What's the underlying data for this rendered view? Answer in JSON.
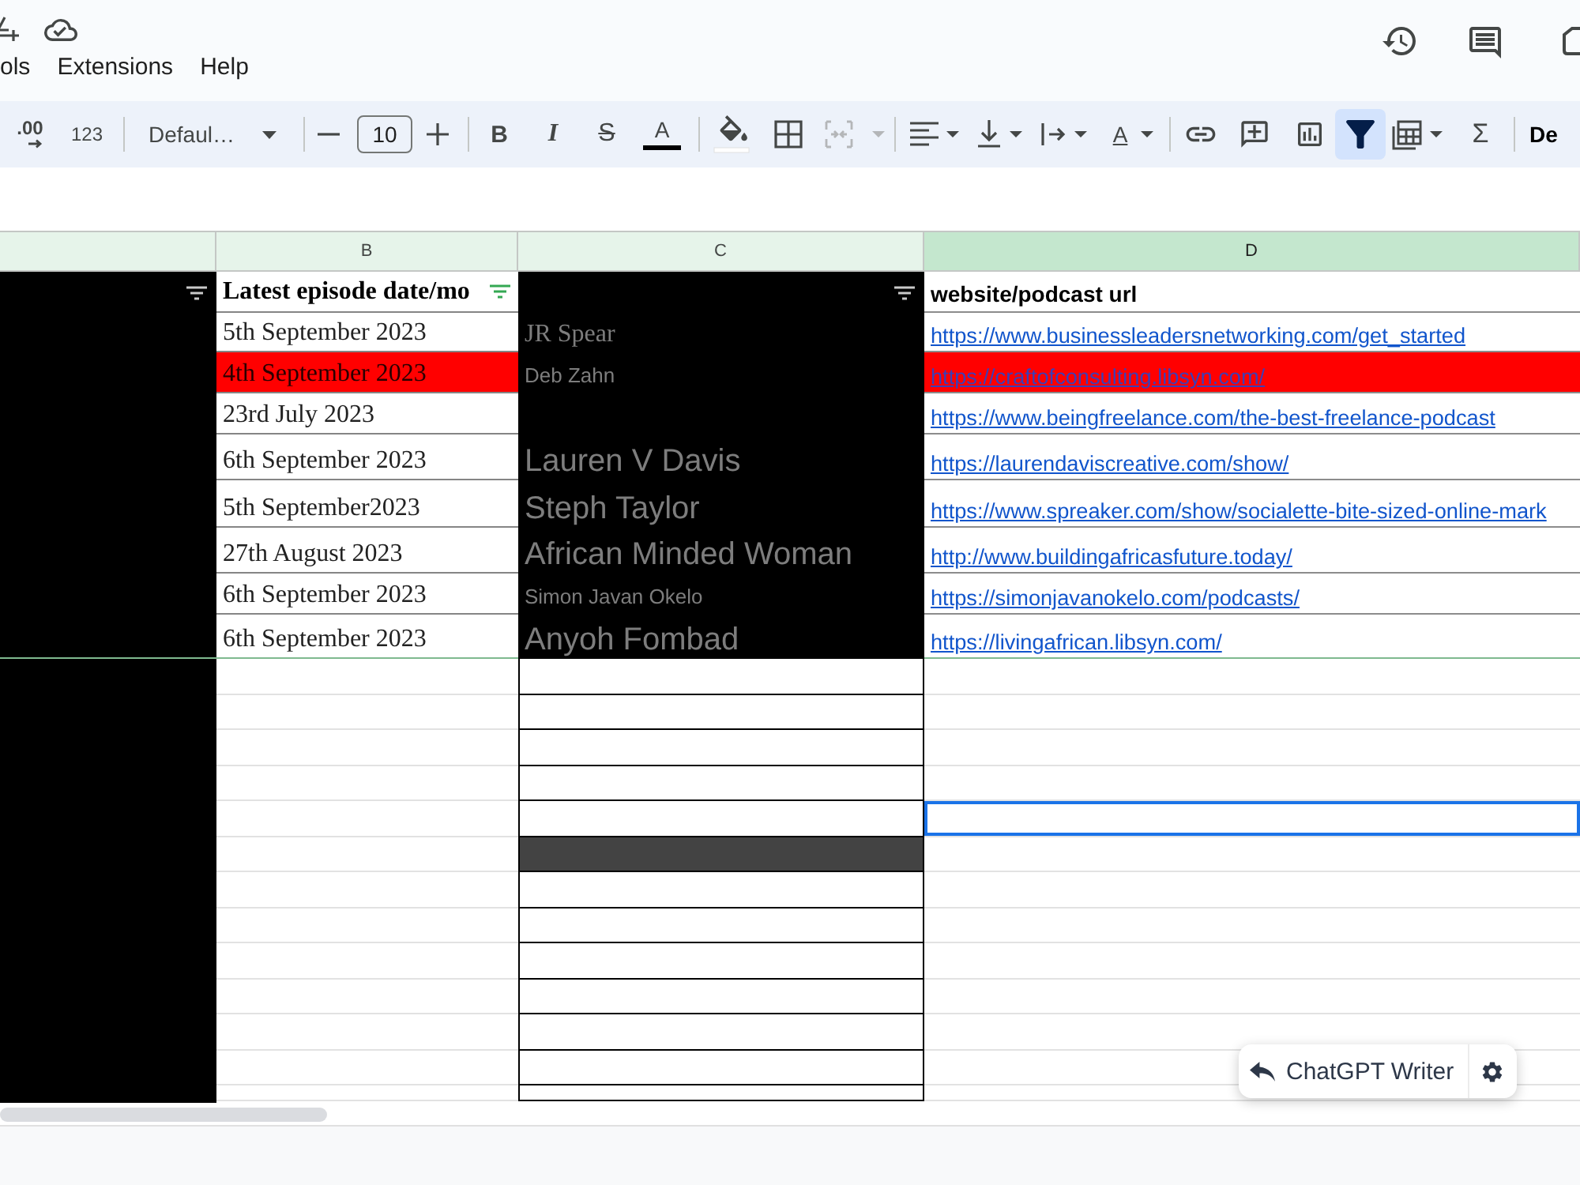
{
  "top_bar": {
    "menu": [
      "ols",
      "Extensions",
      "Help"
    ]
  },
  "toolbar": {
    "decimal": ".00",
    "number_format": "123",
    "font": "Defaul…",
    "font_size": "10",
    "format_letters": [
      "B",
      "I",
      "S",
      "A"
    ],
    "rotate_letter": "A",
    "sum": "Σ",
    "filter_selected": true,
    "cut_label": "De"
  },
  "sheet": {
    "columns": [
      {
        "letter": "B",
        "selected": false
      },
      {
        "letter": "C",
        "selected": false
      },
      {
        "letter": "D",
        "selected": true
      }
    ],
    "filters": [
      {
        "active": false
      },
      {
        "active": true
      },
      {
        "active": false
      }
    ],
    "header": {
      "date": "Latest episode date/mo",
      "url": "website/podcast url"
    },
    "rows": [
      {
        "date": "5th September 2023",
        "name": "JR Spear",
        "url": "https://www.businessleadersnetworking.com/get_started",
        "highlighted": false
      },
      {
        "date": "4th September 2023",
        "name": "Deb Zahn",
        "url": "https://craftofconsulting.libsyn.com/",
        "highlighted": true
      },
      {
        "date": "23rd July 2023",
        "url": "https://www.beingfreelance.com/the-best-freelance-podcast",
        "highlighted": false
      },
      {
        "date": "6th September 2023",
        "name": "Lauren V Davis",
        "url": "https://laurendaviscreative.com/show/",
        "highlighted": false
      },
      {
        "date": "5th September2023",
        "name": "Steph Taylor",
        "url": "https://www.spreaker.com/show/socialette-bite-sized-online-mark",
        "highlighted": false
      },
      {
        "date": "27th August 2023",
        "name": "African Minded Woman",
        "url": "http://www.buildingafricasfuture.today/",
        "highlighted": false
      },
      {
        "date": "6th September 2023",
        "name": "Simon Javan Okelo",
        "url": "https://simonjavanokelo.com/podcasts/",
        "highlighted": false
      },
      {
        "date": "6th September 2023",
        "name": "Anyoh Fombad",
        "url": "https://livingafrican.libsyn.com/",
        "highlighted": false
      }
    ],
    "empty_rows": [
      {
        "selected": false,
        "shaded": false
      },
      {
        "selected": false,
        "shaded": false
      },
      {
        "selected": false,
        "shaded": false
      },
      {
        "selected": false,
        "shaded": false
      },
      {
        "selected": true,
        "shaded": false
      },
      {
        "selected": false,
        "shaded": true
      },
      {
        "selected": false,
        "shaded": false
      },
      {
        "selected": false,
        "shaded": false
      },
      {
        "selected": false,
        "shaded": false
      },
      {
        "selected": false,
        "shaded": false
      },
      {
        "selected": false,
        "shaded": false
      },
      {
        "selected": false,
        "shaded": false
      },
      {
        "selected": false,
        "shaded": false
      }
    ]
  },
  "widget": {
    "label": "ChatGPT Writer"
  }
}
